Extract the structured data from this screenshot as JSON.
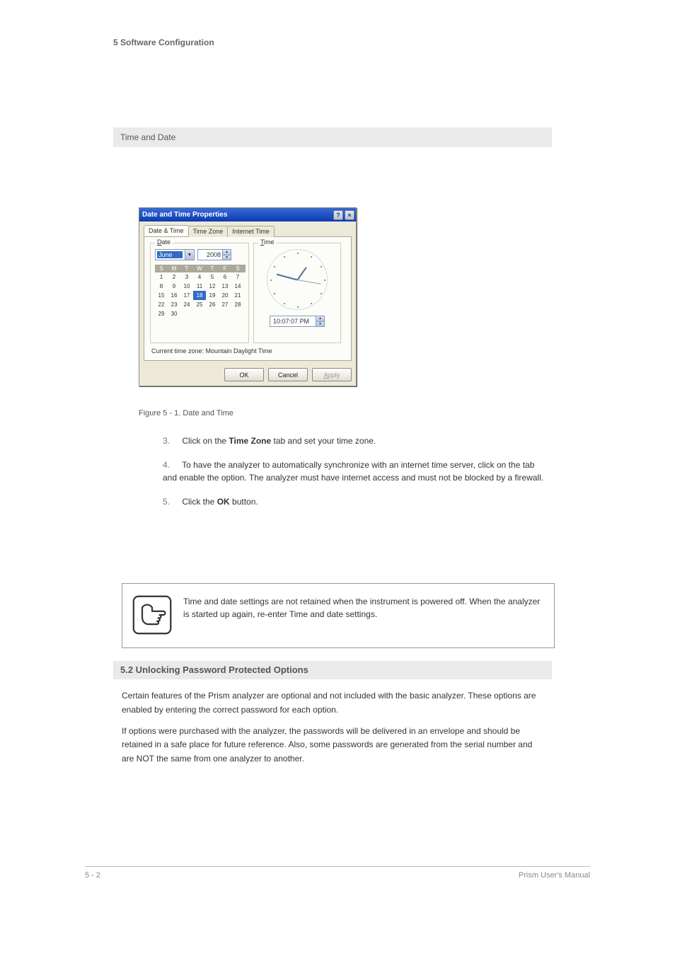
{
  "header": {
    "title": "5 Software Configuration"
  },
  "banner": "Time and Date",
  "dialog": {
    "title": "Date and Time Properties",
    "help_glyph": "?",
    "close_glyph": "×",
    "tabs": [
      "Date & Time",
      "Time Zone",
      "Internet Time"
    ],
    "date": {
      "legend": "Date",
      "month": "June",
      "year": "2008",
      "weekdays": [
        "S",
        "M",
        "T",
        "W",
        "T",
        "F",
        "S"
      ],
      "days": [
        "1",
        "2",
        "3",
        "4",
        "5",
        "6",
        "7",
        "8",
        "9",
        "10",
        "11",
        "12",
        "13",
        "14",
        "15",
        "16",
        "17",
        "18",
        "19",
        "20",
        "21",
        "22",
        "23",
        "24",
        "25",
        "26",
        "27",
        "28",
        "29",
        "30"
      ],
      "selected_day": "18"
    },
    "time": {
      "legend": "Time",
      "value": "10:07:07 PM"
    },
    "tz_line": "Current time zone:  Mountain Daylight Time",
    "buttons": {
      "ok": "OK",
      "cancel": "Cancel",
      "apply": "Apply"
    }
  },
  "figure_caption": "Figure 5 - 1.  Date and Time",
  "steps": {
    "s3": {
      "num": "3.",
      "a": "Click on the ",
      "b": "Time Zone",
      "c": " tab and set your time zone."
    },
    "s4": {
      "num": "4.",
      "text": "To have the analyzer to automatically synchronize with an internet time server, click on the tab and enable the option. The analyzer must have internet access and must not be blocked by a firewall."
    },
    "s5": {
      "num": "5.",
      "a": "Click the ",
      "b": "OK",
      "c": " button."
    }
  },
  "note": "Time and date settings are not retained when the instrument is powered off. When the analyzer is started up again, re-enter Time and date settings.",
  "section": {
    "title": "5.2   Unlocking Password Protected Options",
    "p1": "Certain features of the Prism analyzer are optional and not included with the basic analyzer. These options are enabled by entering the correct password for each option.",
    "p2": "If options were purchased with the analyzer, the passwords will be delivered in an envelope and should be retained in a safe place for future reference. Also, some passwords are generated from the serial number and are NOT the same from one analyzer to another."
  },
  "footer": {
    "left": "5 - 2",
    "right": "Prism User's Manual"
  },
  "icons": {
    "dropdown": "▼",
    "up": "▲",
    "down": "▼"
  }
}
